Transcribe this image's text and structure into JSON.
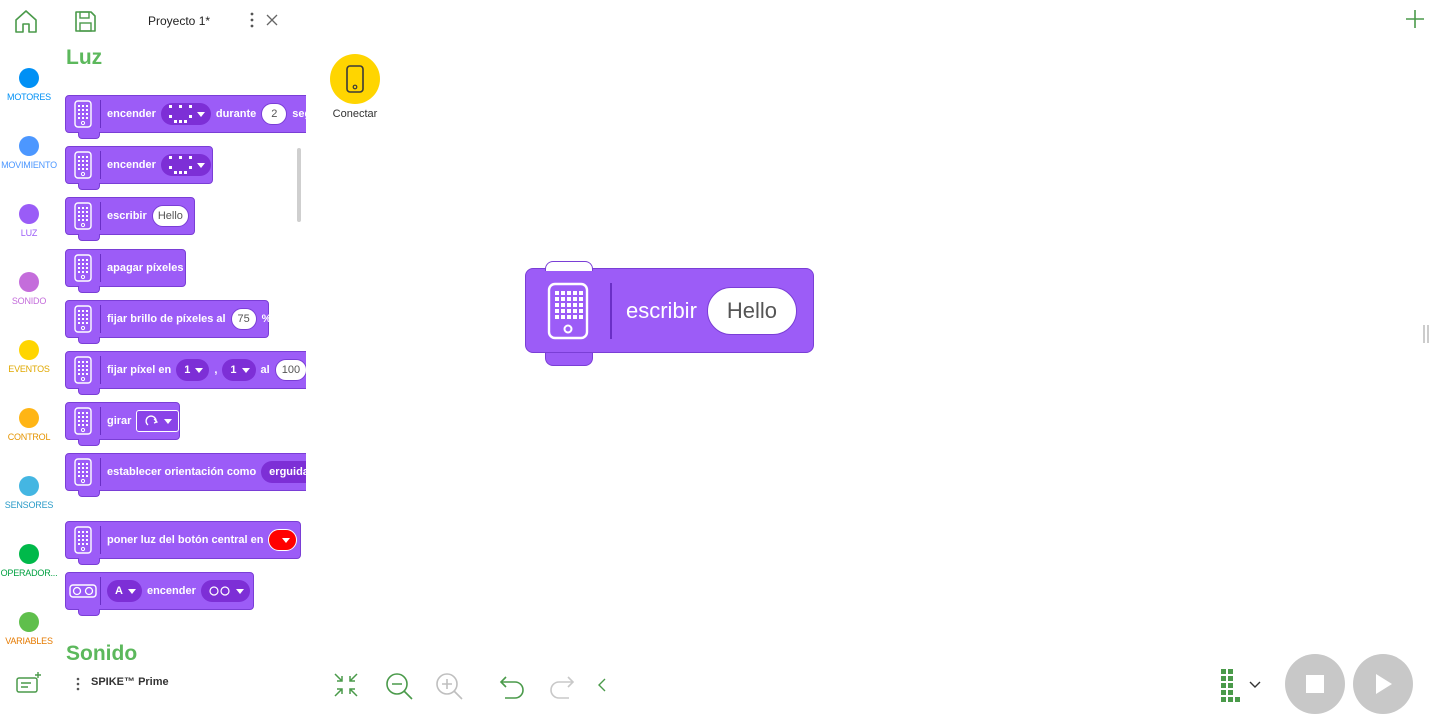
{
  "header": {
    "project_title": "Proyecto 1*"
  },
  "categories": [
    {
      "label": "MOTORES",
      "color": "#0090f5",
      "label_color": "#0090f5"
    },
    {
      "label": "MOVIMIENTO",
      "color": "#4c97ff",
      "label_color": "#4c97ff"
    },
    {
      "label": "LUZ",
      "color": "#9a5cf7",
      "label_color": "#9a5cf7"
    },
    {
      "label": "SONIDO",
      "color": "#c46ddb",
      "label_color": "#c46ddb"
    },
    {
      "label": "EVENTOS",
      "color": "#ffd500",
      "label_color": "#e0a800"
    },
    {
      "label": "CONTROL",
      "color": "#ffb515",
      "label_color": "#e59400"
    },
    {
      "label": "SENSORES",
      "color": "#44b6e2",
      "label_color": "#2a9bc8"
    },
    {
      "label": "OPERADOR...",
      "color": "#00b94a",
      "label_color": "#00a040"
    },
    {
      "label": "VARIABLES",
      "color": "#5fbf4c",
      "label_color": "#e57a00"
    }
  ],
  "palette": {
    "section_luz": "Luz",
    "section_sonido": "Sonido",
    "blocks": {
      "b1": {
        "t1": "encender",
        "t2": "durante",
        "v": "2",
        "t3": "segundos"
      },
      "b2": {
        "t1": "encender"
      },
      "b3": {
        "t1": "escribir",
        "v": "Hello"
      },
      "b4": {
        "t1": "apagar píxeles"
      },
      "b5": {
        "t1": "fijar brillo de píxeles al",
        "v": "75",
        "t2": "%"
      },
      "b6": {
        "t1": "fijar píxel en",
        "d1": "1",
        "c": ",",
        "d2": "1",
        "t2": "al",
        "v": "100"
      },
      "b7": {
        "t1": "girar"
      },
      "b8": {
        "t1": "establecer orientación como",
        "d1": "erguida"
      },
      "b9": {
        "t1": "poner luz del botón central en",
        "color": "#ff0000"
      },
      "b10": {
        "d1": "A",
        "t1": "encender"
      }
    }
  },
  "connect": {
    "label": "Conectar"
  },
  "canvas_block": {
    "label": "escribir",
    "value": "Hello"
  },
  "footer": {
    "hub_label": "SPIKE™ Prime"
  },
  "colors": {
    "accent_green": "#5cb85c",
    "block_purple": "#9c5cf7",
    "connect_yellow": "#ffd500"
  },
  "icons": [
    "home-icon",
    "save-icon",
    "kebab-icon",
    "close-icon",
    "plus-icon",
    "hub-icon",
    "fit-icon",
    "zoom-out-icon",
    "zoom-in-icon",
    "undo-icon",
    "redo-icon",
    "collapse-icon",
    "matrix-icon",
    "stop-icon",
    "play-icon",
    "extension-icon"
  ]
}
